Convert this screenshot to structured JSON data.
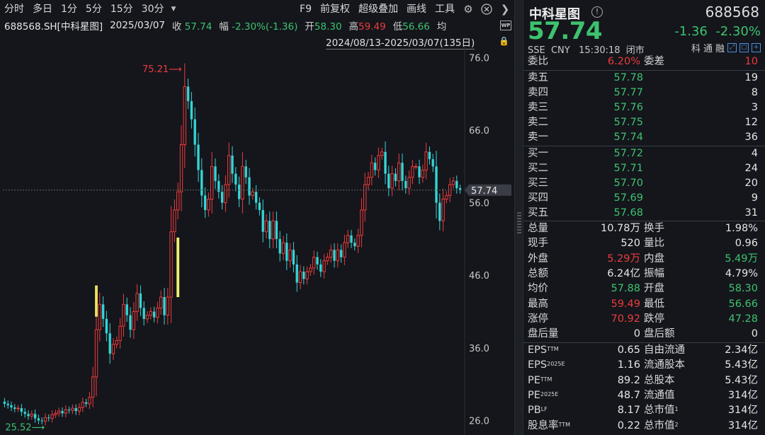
{
  "toolbar": {
    "left_items": [
      "分时",
      "多日",
      "1分",
      "5分",
      "15分",
      "30分"
    ],
    "right_items": [
      "F9",
      "前复权",
      "超级叠加",
      "画线",
      "工具"
    ]
  },
  "info": {
    "code": "688568.SH[中科星图]",
    "date": "2025/03/07",
    "close_label": "收",
    "close": "57.74",
    "range_label": "幅",
    "range": "-2.30%(-1.36)",
    "open_label": "开",
    "open": "58.30",
    "high_label": "高",
    "high": "59.49",
    "low_label": "低",
    "low": "56.66",
    "avg_label": "均"
  },
  "period_range": "2024/08/13-2025/03/07(135日)",
  "chart_data": {
    "type": "candlestick",
    "y_ticks": [
      "76.0",
      "66.0",
      "56.0",
      "46.0",
      "36.0",
      "26.0"
    ],
    "ylim": [
      24.0,
      77.5
    ],
    "last_price": "57.74",
    "max_label": "75.21",
    "min_label": "25.52",
    "up_color": "#ee3b3b",
    "down_color": "#33d6d6",
    "closes": [
      28.3,
      28.1,
      27.8,
      27.6,
      27.7,
      27.2,
      26.9,
      26.6,
      26.9,
      26.3,
      26.0,
      25.9,
      26.4,
      26.3,
      26.8,
      27.0,
      27.3,
      27.0,
      27.5,
      27.4,
      27.7,
      27.3,
      27.8,
      28.5,
      28.3,
      29.2,
      32.0,
      38.5,
      42.0,
      40.0,
      38.0,
      35.2,
      36.5,
      37.0,
      39.0,
      42.0,
      40.5,
      38.5,
      41.0,
      43.5,
      41.5,
      40.0,
      40.5,
      41.0,
      40.2,
      41.5,
      43.0,
      40.5,
      43.0,
      52.0,
      55.0,
      57.5,
      64.0,
      72.0,
      70.0,
      67.5,
      64.0,
      60.5,
      57.0,
      55.0,
      56.5,
      61.0,
      59.0,
      57.5,
      56.0,
      58.5,
      62.5,
      60.0,
      58.5,
      56.5,
      61.0,
      59.5,
      57.0,
      57.5,
      56.0,
      55.0,
      52.0,
      53.5,
      51.0,
      53.5,
      51.0,
      49.0,
      50.5,
      48.0,
      49.5,
      47.5,
      45.0,
      46.5,
      45.5,
      46.5,
      47.0,
      48.5,
      47.5,
      46.5,
      48.0,
      48.5,
      49.5,
      48.0,
      49.5,
      48.5,
      50.5,
      51.5,
      50.5,
      50.0,
      51.5,
      55.0,
      58.5,
      59.5,
      61.5,
      60.5,
      62.5,
      63.0,
      60.0,
      58.0,
      60.0,
      59.0,
      61.5,
      59.0,
      58.0,
      59.5,
      61.0,
      61.0,
      59.5,
      60.5,
      63.0,
      62.0,
      61.0,
      56.0,
      53.5,
      56.5,
      57.0,
      58.5,
      59.0,
      58.0,
      57.74
    ],
    "highlight_bars": [
      {
        "index": 27,
        "high": 44.6,
        "low": 40.3,
        "color": "#f0e060"
      },
      {
        "index": 51,
        "high": 51.2,
        "low": 43.0,
        "color": "#f0f070"
      }
    ]
  },
  "quote": {
    "name": "中科星图",
    "code": "688568",
    "price": "57.74",
    "change": "-1.36",
    "change_pct": "-2.30%",
    "exchange": "SSE",
    "currency": "CNY",
    "time": "15:30:18",
    "status": "闭市",
    "tags": [
      "科",
      "通",
      "融"
    ],
    "weibi_label": "委比",
    "weibi": "6.20%",
    "weicha_label": "委差",
    "weicha": "10",
    "asks": [
      {
        "label": "卖五",
        "price": "57.78",
        "vol": "19"
      },
      {
        "label": "卖四",
        "price": "57.77",
        "vol": "8"
      },
      {
        "label": "卖三",
        "price": "57.76",
        "vol": "3"
      },
      {
        "label": "卖二",
        "price": "57.75",
        "vol": "12"
      },
      {
        "label": "卖一",
        "price": "57.74",
        "vol": "36"
      }
    ],
    "bids": [
      {
        "label": "买一",
        "price": "57.72",
        "vol": "4"
      },
      {
        "label": "买二",
        "price": "57.71",
        "vol": "24"
      },
      {
        "label": "买三",
        "price": "57.70",
        "vol": "20"
      },
      {
        "label": "买四",
        "price": "57.69",
        "vol": "9"
      },
      {
        "label": "买五",
        "price": "57.68",
        "vol": "31"
      }
    ],
    "stats": [
      {
        "l1": "总量",
        "v1": "10.78万",
        "c1": "#e6e6e6",
        "l2": "换手",
        "v2": "1.98%",
        "c2": "#e6e6e6"
      },
      {
        "l1": "现手",
        "v1": "520",
        "c1": "#e6e6e6",
        "l2": "量比",
        "v2": "0.96",
        "c2": "#e6e6e6"
      },
      {
        "l1": "外盘",
        "v1": "5.29万",
        "c1": "#ee3b3b",
        "l2": "内盘",
        "v2": "5.49万",
        "c2": "#3ec26e"
      },
      {
        "l1": "总额",
        "v1": "6.24亿",
        "c1": "#e6e6e6",
        "l2": "振幅",
        "v2": "4.79%",
        "c2": "#e6e6e6"
      },
      {
        "l1": "均价",
        "v1": "57.88",
        "c1": "#3ec26e",
        "l2": "开盘",
        "v2": "58.30",
        "c2": "#3ec26e"
      },
      {
        "l1": "最高",
        "v1": "59.49",
        "c1": "#ee3b3b",
        "l2": "最低",
        "v2": "56.66",
        "c2": "#3ec26e"
      },
      {
        "l1": "涨停",
        "v1": "70.92",
        "c1": "#ee3b3b",
        "l2": "跌停",
        "v2": "47.28",
        "c2": "#3ec26e"
      },
      {
        "l1": "盘后量",
        "v1": "0",
        "c1": "#e6e6e6",
        "l2": "盘后额",
        "v2": "0",
        "c2": "#e6e6e6"
      }
    ],
    "fundamentals": [
      {
        "l1": "EPS",
        "s1": "TTM",
        "v1": "0.65",
        "l2": "自由流通",
        "s2": "",
        "v2": "2.34亿"
      },
      {
        "l1": "EPS",
        "s1": "2025E",
        "v1": "1.16",
        "l2": "流通股本",
        "s2": "",
        "v2": "5.43亿"
      },
      {
        "l1": "PE",
        "s1": "TTM",
        "v1": "89.2",
        "l2": "总股本",
        "s2": "",
        "v2": "5.43亿"
      },
      {
        "l1": "PE",
        "s1": "2025E",
        "v1": "48.7",
        "l2": "流通值",
        "s2": "",
        "v2": "314亿"
      },
      {
        "l1": "PB",
        "s1": "LF",
        "v1": "8.17",
        "l2": "总市值",
        "s2": "1",
        "v2": "314亿"
      },
      {
        "l1": "股息率",
        "s1": "TTM",
        "v1": "0.22",
        "l2": "总市值",
        "s2": "2",
        "v2": "314亿"
      }
    ]
  }
}
